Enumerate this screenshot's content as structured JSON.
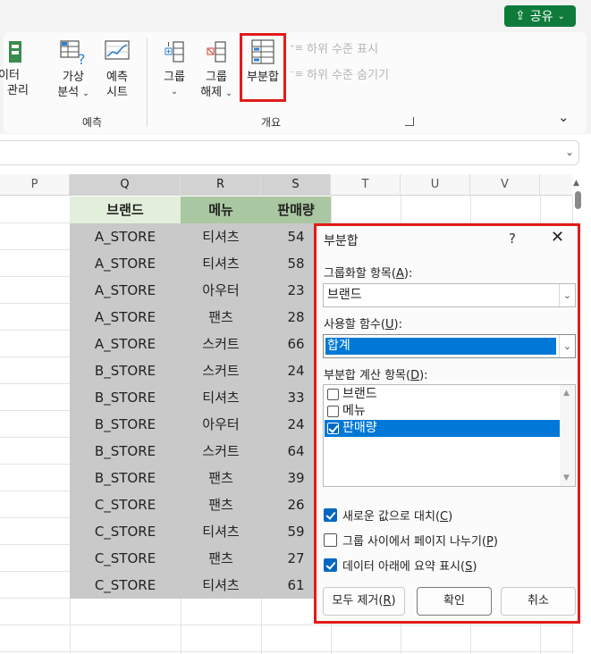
{
  "ribbon": {
    "share_label": "공유",
    "cut_left": {
      "line1": "이터",
      "line2": "관리"
    },
    "what_if": {
      "line1": "가상",
      "line2": "분석"
    },
    "forecast_sheet": {
      "line1": "예측",
      "line2": "시트"
    },
    "group": {
      "line1": "그룹"
    },
    "ungroup": {
      "line1": "그룹",
      "line2": "해제"
    },
    "subtotal": {
      "label": "부분합"
    },
    "show_detail": "하위 수준 표시",
    "hide_detail": "하위 수준 숨기기",
    "group_forecast_label": "예측",
    "group_outline_label": "개요",
    "colors": {
      "share": "#0f7b3a",
      "highlight": "#e21b1b"
    }
  },
  "columns": [
    "P",
    "Q",
    "R",
    "S",
    "T",
    "U",
    "V"
  ],
  "table": {
    "headers": [
      "브랜드",
      "메뉴",
      "판매량"
    ],
    "rows": [
      [
        "A_STORE",
        "티셔츠",
        "54"
      ],
      [
        "A_STORE",
        "티셔츠",
        "58"
      ],
      [
        "A_STORE",
        "아우터",
        "23"
      ],
      [
        "A_STORE",
        "팬츠",
        "28"
      ],
      [
        "A_STORE",
        "스커트",
        "66"
      ],
      [
        "B_STORE",
        "스커트",
        "24"
      ],
      [
        "B_STORE",
        "티셔츠",
        "33"
      ],
      [
        "B_STORE",
        "아우터",
        "24"
      ],
      [
        "B_STORE",
        "스커트",
        "64"
      ],
      [
        "B_STORE",
        "팬츠",
        "39"
      ],
      [
        "C_STORE",
        "팬츠",
        "26"
      ],
      [
        "C_STORE",
        "티셔츠",
        "59"
      ],
      [
        "C_STORE",
        "팬츠",
        "27"
      ],
      [
        "C_STORE",
        "티셔츠",
        "61"
      ]
    ],
    "colors": {
      "header_q": "#e2efda",
      "header_rs": "#a9c7a0",
      "body": "#c9c9c9"
    }
  },
  "dialog": {
    "title": "부분합",
    "help": "?",
    "close": "✕",
    "group_by": {
      "label_pre": "그룹화할 항목(",
      "key": "A",
      "label_post": "):",
      "value": "브랜드"
    },
    "function": {
      "label_pre": "사용할 함수(",
      "key": "U",
      "label_post": "):",
      "value": "합계"
    },
    "add_to": {
      "label_pre": "부분합 계산 항목(",
      "key": "D",
      "label_post": "):",
      "items": [
        {
          "label": "브랜드",
          "checked": false
        },
        {
          "label": "메뉴",
          "checked": false
        },
        {
          "label": "판매량",
          "checked": true
        }
      ]
    },
    "replace_current": {
      "pre": "새로운 값으로 대치(",
      "key": "C",
      "post": ")",
      "checked": true
    },
    "page_break": {
      "pre": "그룹 사이에서 페이지 나누기(",
      "key": "P",
      "post": ")",
      "checked": false
    },
    "summary_below": {
      "pre": "데이터 아래에 요약 표시(",
      "key": "S",
      "post": ")",
      "checked": true
    },
    "remove_all": {
      "pre": "모두 제거(",
      "key": "R",
      "post": ")"
    },
    "ok": "확인",
    "cancel": "취소"
  }
}
